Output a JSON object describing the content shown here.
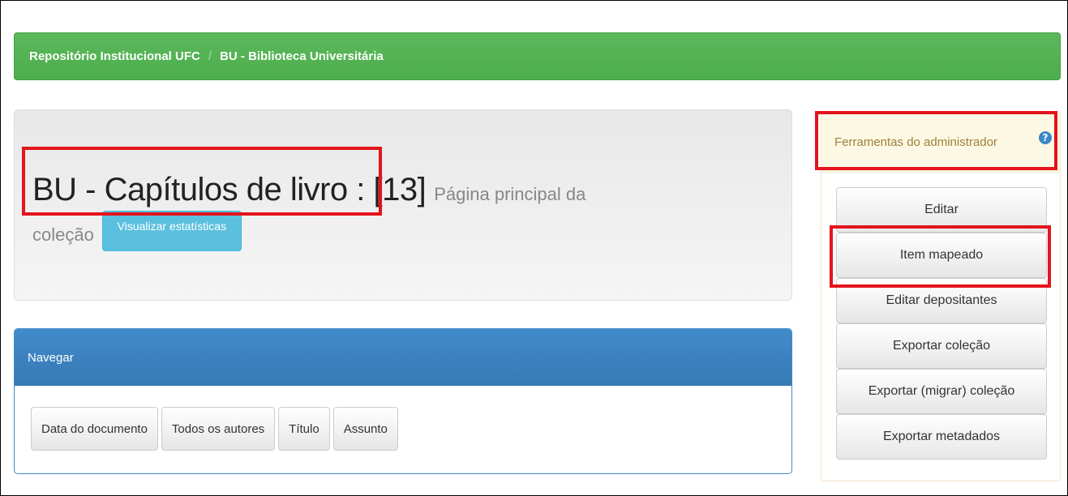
{
  "breadcrumb": {
    "root": "Repositório Institucional UFC",
    "separator": "/",
    "current": "BU - Biblioteca Universitária"
  },
  "collection": {
    "title": "BU - Capítulos de livro : [13]",
    "subtitle_part1": "Página principal da",
    "subtitle_part2": "coleção",
    "stats_button": "Visualizar estatísticas"
  },
  "browse": {
    "heading": "Navegar",
    "buttons": [
      "Data do documento",
      "Todos os autores",
      "Título",
      "Assunto"
    ]
  },
  "admin": {
    "heading": "Ferramentas do administrador",
    "help_icon": "?",
    "buttons": [
      "Editar",
      "Item mapeado",
      "Editar depositantes",
      "Exportar coleção",
      "Exportar (migrar) coleção",
      "Exportar metadados"
    ]
  },
  "colors": {
    "breadcrumb_bg": "#5cb85c",
    "panel_head": "#428bca",
    "info_button": "#5bc0de",
    "highlight": "#e3141c"
  }
}
